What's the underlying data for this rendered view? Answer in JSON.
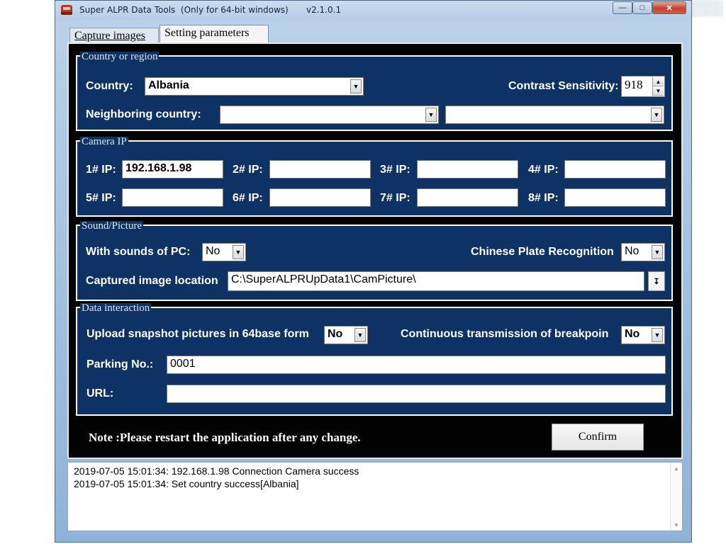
{
  "window": {
    "title": "Super ALPR Data Tools  (Only for 64-bit windows)",
    "version": "v2.1.0.1"
  },
  "tabs": [
    {
      "label": "Capture images",
      "active": false
    },
    {
      "label": "Setting parameters",
      "active": true
    }
  ],
  "country_group": {
    "legend": "Country or region",
    "country_label": "Country:",
    "country_value": "Albania",
    "contrast_label": "Contrast Sensitivity:",
    "contrast_value": "918",
    "neighbor_label": "Neighboring country:",
    "neighbor_value_1": "",
    "neighbor_value_2": ""
  },
  "camera_group": {
    "legend": "Camera IP",
    "cameras": [
      {
        "label": "1# IP:",
        "value": "192.168.1.98"
      },
      {
        "label": "2# IP:",
        "value": ""
      },
      {
        "label": "3# IP:",
        "value": ""
      },
      {
        "label": "4# IP:",
        "value": ""
      },
      {
        "label": "5# IP:",
        "value": ""
      },
      {
        "label": "6# IP:",
        "value": ""
      },
      {
        "label": "7# IP:",
        "value": ""
      },
      {
        "label": "8# IP:",
        "value": ""
      }
    ]
  },
  "sound_group": {
    "legend": "Sound/Picture",
    "sound_label": "With sounds of  PC:",
    "sound_value": "No",
    "plate_label": "Chinese Plate Recognition",
    "plate_value": "No",
    "location_label": "Captured image location",
    "location_value": "C:\\SuperALPRUpData1\\CamPicture\\"
  },
  "data_group": {
    "legend": "Data interaction",
    "upload_label": "Upload snapshot pictures in 64base form",
    "upload_value": "No",
    "continuous_label": "Continuous transmission of breakpoin",
    "continuous_value": "No",
    "parking_label": "Parking No.:",
    "parking_value": "0001",
    "url_label": "URL:",
    "url_value": ""
  },
  "footer": {
    "note": "Note :Please restart the application after any change.",
    "confirm_label": "Confirm"
  },
  "log": {
    "lines": [
      "2019-07-05 15:01:34: 192.168.1.98 Connection Camera success",
      "2019-07-05 15:01:34: Set country success[Albania]"
    ]
  }
}
